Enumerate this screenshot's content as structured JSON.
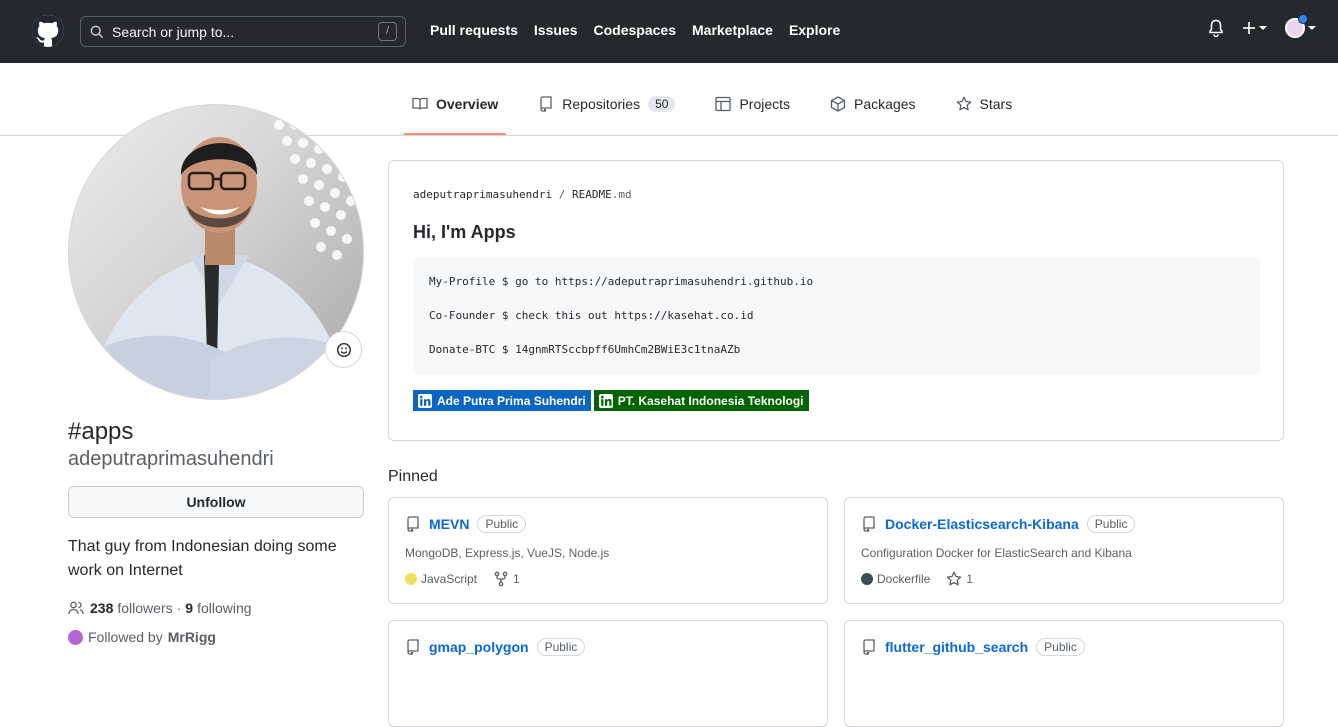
{
  "header": {
    "search_placeholder": "Search or jump to...",
    "search_key": "/",
    "nav": [
      "Pull requests",
      "Issues",
      "Codespaces",
      "Marketplace",
      "Explore"
    ]
  },
  "tabs": [
    {
      "label": "Overview",
      "icon": "book-icon",
      "active": true
    },
    {
      "label": "Repositories",
      "icon": "repo-icon",
      "count": "50"
    },
    {
      "label": "Projects",
      "icon": "table-icon"
    },
    {
      "label": "Packages",
      "icon": "package-icon"
    },
    {
      "label": "Stars",
      "icon": "star-icon"
    }
  ],
  "profile": {
    "name": "#apps",
    "login": "adeputraprimasuhendri",
    "unfollow_label": "Unfollow",
    "bio": "That guy from Indonesian doing some work on Internet",
    "followers_count": "238",
    "followers_label": "followers",
    "separator": "·",
    "following_count": "9",
    "following_label": "following",
    "followed_by_label": "Followed by",
    "followed_by_user": "MrRigg"
  },
  "readme": {
    "owner": "adeputraprimasuhendri",
    "slash": "/",
    "file": "README",
    "ext": ".md",
    "heading": "Hi, I'm Apps",
    "code_lines": [
      "My-Profile $ go to https://adeputraprimasuhendri.github.io",
      "Co-Founder $ check this out https://kasehat.co.id",
      "Donate-BTC $ 14gnmRTSccbpff6UmhCm2BWiE3c1tnaAZb"
    ],
    "badges": [
      {
        "label": "Ade Putra Prima Suhendri",
        "color": "#0a66c2"
      },
      {
        "label": "PT. Kasehat Indonesia Teknologi",
        "color": "#006400"
      }
    ]
  },
  "pinned": {
    "title": "Pinned",
    "cards": [
      {
        "name": "MEVN",
        "visibility": "Public",
        "description": "MongoDB, Express.js, VueJS, Node.js",
        "language": "JavaScript",
        "lang_color": "#f1e05a",
        "stat_icon": "fork-icon",
        "stat": "1"
      },
      {
        "name": "Docker-Elasticsearch-Kibana",
        "visibility": "Public",
        "description": "Configuration Docker for ElasticSearch and Kibana",
        "language": "Dockerfile",
        "lang_color": "#384d54",
        "stat_icon": "star-icon",
        "stat": "1"
      },
      {
        "name": "gmap_polygon",
        "visibility": "Public"
      },
      {
        "name": "flutter_github_search",
        "visibility": "Public"
      }
    ]
  },
  "colors": {
    "header_bg": "#24292f",
    "link": "#0969da",
    "tab_underline": "#fd8c73"
  }
}
